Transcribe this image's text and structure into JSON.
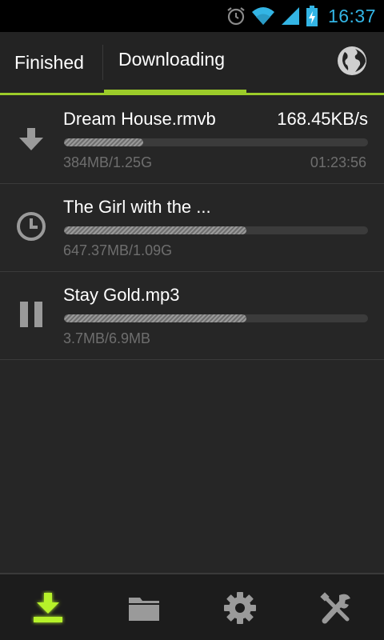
{
  "status_bar": {
    "time": "16:37",
    "icons": [
      "alarm-icon",
      "wifi-icon",
      "signal-icon",
      "battery-charging-icon"
    ],
    "accent_color": "#33b5e5"
  },
  "tabs": [
    {
      "label": "Finished",
      "selected": false
    },
    {
      "label": "Downloading",
      "selected": true
    }
  ],
  "header": {
    "action_icon": "globe-icon",
    "accent_color": "#9ccc2a"
  },
  "downloads": [
    {
      "name": "Dream House.rmvb",
      "speed": "168.45KB/s",
      "size": "384MB/1.25G",
      "time_left": "01:23:56",
      "progress": 0.26,
      "state_icon": "download-arrow-icon"
    },
    {
      "name": "The Girl with the ...",
      "speed": "",
      "size": "647.37MB/1.09G",
      "time_left": "",
      "progress": 0.6,
      "state_icon": "clock-icon"
    },
    {
      "name": "Stay Gold.mp3",
      "speed": "",
      "size": "3.7MB/6.9MB",
      "time_left": "",
      "progress": 0.6,
      "state_icon": "pause-icon"
    }
  ],
  "bottom_bar": [
    {
      "icon": "download-icon",
      "active": true
    },
    {
      "icon": "folder-icon",
      "active": false
    },
    {
      "icon": "gear-icon",
      "active": false
    },
    {
      "icon": "tools-icon",
      "active": false
    }
  ]
}
